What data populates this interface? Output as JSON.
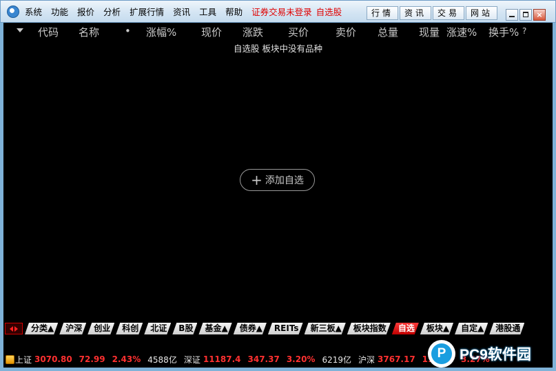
{
  "menu": {
    "items": [
      "系统",
      "功能",
      "报价",
      "分析",
      "扩展行情",
      "资讯",
      "工具",
      "帮助"
    ],
    "login_status": "证券交易未登录",
    "current_view": "自选股",
    "tab_buttons": [
      "行情",
      "资讯",
      "交易",
      "网站"
    ]
  },
  "window_controls": {
    "close_glyph": "×"
  },
  "columns": {
    "code": "代码",
    "name": "名称",
    "dot": "•",
    "change_pct": "涨幅%",
    "price": "现价",
    "change": "涨跌",
    "bid": "买价",
    "ask": "卖价",
    "total_volume": "总量",
    "current_volume": "现量",
    "speed": "涨速%",
    "turnover": "换手%",
    "help": "?"
  },
  "empty_message": "自选股 板块中没有品种",
  "add_button": {
    "plus": "+",
    "label": "添加自选"
  },
  "bottom_tabs": [
    {
      "label": "分类▲",
      "active": false
    },
    {
      "label": "沪深",
      "active": false
    },
    {
      "label": "创业",
      "active": false
    },
    {
      "label": "科创",
      "active": false
    },
    {
      "label": "北证",
      "active": false
    },
    {
      "label": "B股",
      "active": false
    },
    {
      "label": "基金▲",
      "active": false
    },
    {
      "label": "债券▲",
      "active": false
    },
    {
      "label": "REITs",
      "active": false
    },
    {
      "label": "新三板▲",
      "active": false
    },
    {
      "label": "板块指数",
      "active": false
    },
    {
      "label": "自选",
      "active": true
    },
    {
      "label": "板块▲",
      "active": false
    },
    {
      "label": "自定▲",
      "active": false
    },
    {
      "label": "港股通",
      "active": false
    }
  ],
  "status_bar": {
    "indices": [
      {
        "name": "上证",
        "value": "3070.80",
        "change": "72.99",
        "pct": "2.43%",
        "volume": "4588亿"
      },
      {
        "name": "深证",
        "value": "11187.4",
        "change": "347.37",
        "pct": "3.20%",
        "volume": "6219亿"
      },
      {
        "name": "沪深",
        "value": "3767.17",
        "change": "119.27",
        "pct": "3.27%",
        "volume": ""
      }
    ]
  },
  "watermark": {
    "badge": "P",
    "text": "PC9软件园"
  },
  "colors": {
    "accent_red": "#ff3030",
    "menu_bg": "#d4e5f3",
    "header_text": "#c8c8c8"
  }
}
